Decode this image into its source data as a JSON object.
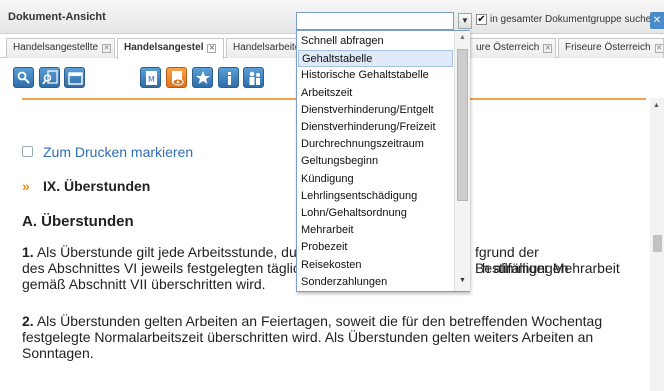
{
  "header": {
    "title": "Dokument-Ansicht",
    "quick_select_value": "",
    "group_search_checked": true,
    "group_search_label": "in gesamter Dokumentgruppe suchen"
  },
  "tabs": [
    {
      "label": "Handelsangestellte",
      "active": false
    },
    {
      "label": "Handelsangestel",
      "active": true
    },
    {
      "label": "Handelsarbeite",
      "active": false
    },
    {
      "label": "ure Österreich",
      "active": false
    },
    {
      "label": "Friseure Österreich",
      "active": false
    }
  ],
  "tab_close_glyph": "✕",
  "toolbar": {
    "icons": [
      "search-user-icon",
      "search-document-icon",
      "window-icon",
      "document-m-icon",
      "document-view-icon",
      "star-add-icon",
      "info-icon",
      "people-icon"
    ]
  },
  "content": {
    "print_label": "Zum Drucken markieren",
    "chapter_marker": "»",
    "chapter_title": "IX. Überstunden",
    "section_title": "A. Überstunden",
    "para1_num": "1.",
    "para1_line1_a": "Als Überstunde gilt jede Arbeitsstunde, du",
    "para1_line1_b": "fgrund der Bestimmungen",
    "para1_line2_a": "des Abschnittes VI jeweils festgelegten täglic",
    "para1_line2_b": "h allfälliger Mehrarbeit",
    "para1_line3": "gemäß Abschnitt VII überschritten wird.",
    "para2_num": "2.",
    "para2_text": "Als Überstunden gelten Arbeiten an Feiertagen, soweit die für den betreffenden Wochentag festgelegte Normalarbeitszeit überschritten wird. Als Überstunden gelten weiters Arbeiten an Sonntagen."
  },
  "dropdown": {
    "items": [
      "Schnell abfragen",
      "Gehaltstabelle",
      "Historische Gehaltstabelle",
      "Arbeitszeit",
      "Dienstverhinderung/Entgelt",
      "Dienstverhinderung/Freizeit",
      "Durchrechnungszeitraum",
      "Geltungsbeginn",
      "Kündigung",
      "Lehrlingsentschädigung",
      "Lohn/Gehaltsordnung",
      "Mehrarbeit",
      "Probezeit",
      "Reisekosten",
      "Sonderzahlungen"
    ],
    "selected_index": 1
  },
  "colors": {
    "accent_orange": "#f28a1d",
    "link_blue": "#2e6db4",
    "button_blue": "#2f6ea8"
  }
}
